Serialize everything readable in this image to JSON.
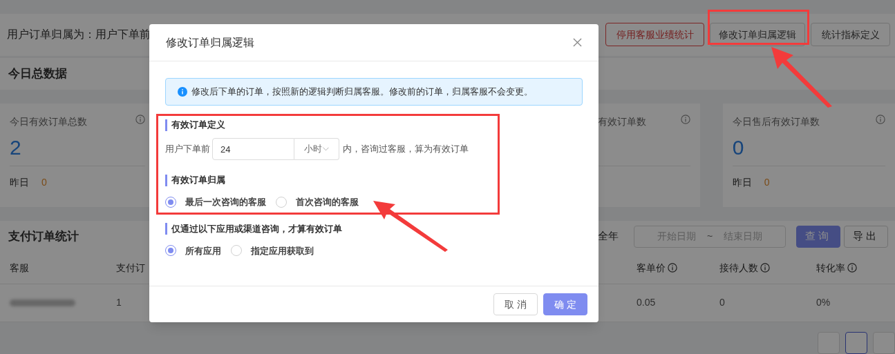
{
  "page": {
    "attribution_text": "用户订单归属为：用户下单前",
    "header_buttons": [
      {
        "label": "停用客服业绩统计",
        "kind": "danger"
      },
      {
        "label": "修改订单归属逻辑",
        "kind": "default"
      },
      {
        "label": "统计指标定义",
        "kind": "default"
      }
    ],
    "today_section": {
      "title": "今日总数据",
      "cards": [
        {
          "label": "今日有效订单总数",
          "value": "2",
          "yesterday_label": "昨日",
          "yesterday_value": "0"
        },
        {
          "label": "有效订单数"
        },
        {
          "label": "今日售后有效订单数",
          "value": "0",
          "yesterday_label": "昨日",
          "yesterday_value": "0"
        }
      ]
    },
    "payment_section": {
      "title": "支付订单统计",
      "period": "全年",
      "start_placeholder": "开始日期",
      "separator": "~",
      "end_placeholder": "结束日期",
      "buttons": [
        {
          "label": "查询",
          "kind": "primary"
        },
        {
          "label": "导出",
          "kind": "default"
        }
      ]
    },
    "table": {
      "columns": [
        {
          "label": "客服"
        },
        {
          "label": "支付订"
        },
        {
          "label": "客单价",
          "info": true
        },
        {
          "label": "接待人数",
          "info": true
        },
        {
          "label": "转化率",
          "info": true
        }
      ],
      "rows": [
        {
          "redacted_name": true,
          "cells": [
            "",
            "1",
            "0.05",
            "0",
            "0%"
          ]
        }
      ]
    }
  },
  "dialog": {
    "title": "修改订单归属逻辑",
    "alert": "修改后下单的订单，按照新的逻辑判断归属客服。修改前的订单，归属客服不会变更。",
    "sections": [
      {
        "kind": "definition",
        "title": "有效订单定义",
        "prefix": "用户下单前",
        "value": "24",
        "unit": "小时",
        "suffix": "内，咨询过客服，算为有效订单"
      },
      {
        "kind": "radios",
        "title": "有效订单归属",
        "options": [
          {
            "label": "最后一次咨询的客服",
            "selected": true
          },
          {
            "label": "首次咨询的客服",
            "selected": false
          }
        ]
      },
      {
        "kind": "radios",
        "title": "仅通过以下应用或渠道咨询，才算有效订单",
        "options": [
          {
            "label": "所有应用",
            "selected": true
          },
          {
            "label": "指定应用获取到",
            "selected": false
          }
        ]
      }
    ],
    "buttons": [
      {
        "label": "取 消",
        "kind": "default"
      },
      {
        "label": "确 定",
        "kind": "primary"
      }
    ]
  }
}
